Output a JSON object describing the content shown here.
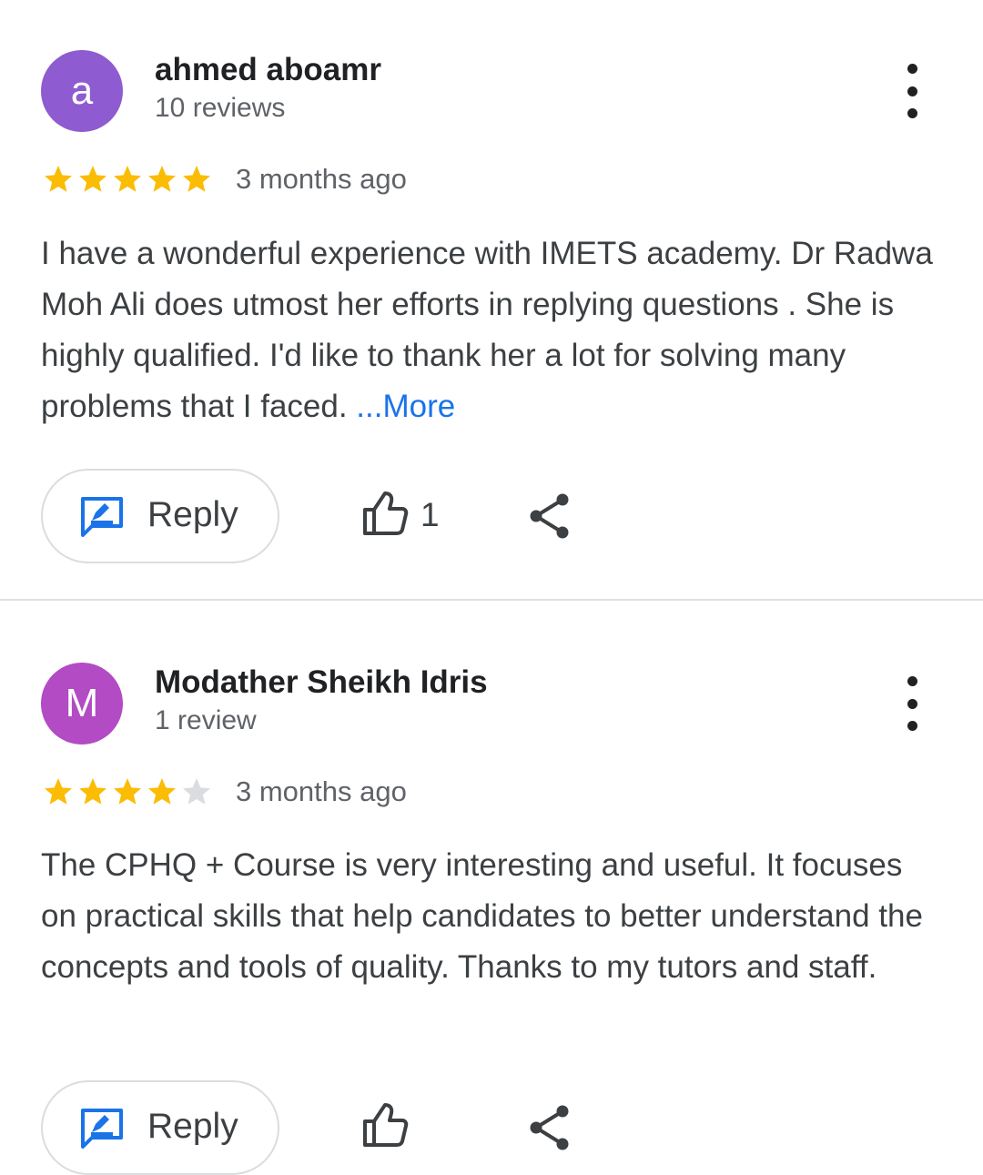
{
  "reviews": [
    {
      "avatar_letter": "a",
      "avatar_color": "#8e5bd0",
      "author": "ahmed aboamr",
      "review_count": "10 reviews",
      "rating": 5,
      "time": "3 months ago",
      "text": "I have a wonderful experience with IMETS academy. Dr Radwa Moh Ali does utmost her efforts in replying questions . She is highly qualified. I'd like to thank her a lot for solving many problems that I faced. ",
      "more_label": "...More",
      "reply_label": "Reply",
      "likes": "1"
    },
    {
      "avatar_letter": "M",
      "avatar_color": "#b24bc4",
      "author": "Modather Sheikh Idris",
      "review_count": "1 review",
      "rating": 4,
      "time": "3 months ago",
      "text": "The CPHQ + Course is very interesting and useful. It focuses on practical skills that help candidates to better understand the concepts and tools of quality. Thanks to my tutors and staff.",
      "reply_label": "Reply"
    }
  ],
  "colors": {
    "star_filled": "#fbbc04",
    "star_empty": "#dadce0",
    "link": "#1a73e8",
    "reply_icon": "#1a73e8"
  },
  "icons": [
    "more-vert-icon",
    "star-icon",
    "reply-icon",
    "thumb-up-icon",
    "share-icon"
  ]
}
